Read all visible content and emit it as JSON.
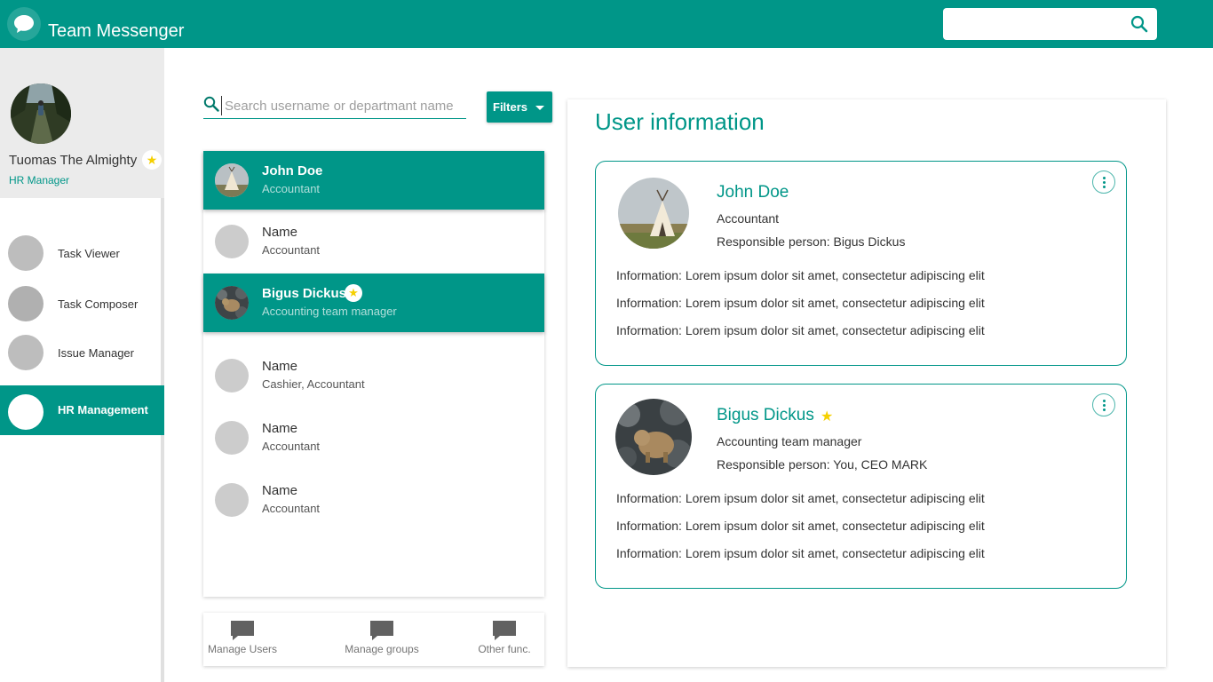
{
  "app": {
    "title": "Team Messenger",
    "accent": "#009688"
  },
  "header": {
    "search_placeholder": ""
  },
  "profile": {
    "name": "Tuomas The Almighty",
    "role": "HR Manager",
    "star": "★"
  },
  "nav": [
    {
      "label": "Task Viewer",
      "active": false
    },
    {
      "label": "Task Composer",
      "active": false
    },
    {
      "label": "Issue Manager",
      "active": false
    },
    {
      "label": "HR Management",
      "active": true
    }
  ],
  "search": {
    "placeholder": "Search username or departmant name",
    "value": ""
  },
  "filter": {
    "label": "Filters"
  },
  "users": [
    {
      "name": "John Doe",
      "role": "Accountant",
      "selected": true,
      "starred": false,
      "photo": "teepee"
    },
    {
      "name": "Name",
      "role": "Accountant",
      "selected": false,
      "starred": false,
      "photo": ""
    },
    {
      "name": "Bigus Dickus",
      "role": "Accounting team manager",
      "selected": true,
      "starred": true,
      "photo": "bear"
    },
    {
      "name": "Name",
      "role": "Cashier, Accountant",
      "selected": false,
      "starred": false,
      "photo": ""
    },
    {
      "name": "Name",
      "role": "Accountant",
      "selected": false,
      "starred": false,
      "photo": ""
    },
    {
      "name": "Name",
      "role": "Accountant",
      "selected": false,
      "starred": false,
      "photo": ""
    }
  ],
  "star_glyph": "★",
  "bottom": [
    {
      "label": "Manage Users",
      "icon": "chat-bubble-icon"
    },
    {
      "label": "Manage groups",
      "icon": "chat-bubble-icon"
    },
    {
      "label": "Other func.",
      "icon": "chat-bubble-icon"
    }
  ],
  "info": {
    "title": "User information",
    "cards": [
      {
        "name": "John Doe",
        "role": "Accountant",
        "responsible": "Responsible person: Bigus Dickus",
        "starred": false,
        "info": [
          "Information: Lorem ipsum dolor sit amet, consectetur adipiscing elit",
          "Information: Lorem ipsum dolor sit amet, consectetur adipiscing elit",
          "Information: Lorem ipsum dolor sit amet, consectetur adipiscing elit"
        ]
      },
      {
        "name": "Bigus Dickus",
        "role": "Accounting team manager",
        "responsible": "Responsible person: You, CEO MARK",
        "starred": true,
        "info": [
          "Information: Lorem ipsum dolor sit amet, consectetur adipiscing elit",
          "Information: Lorem ipsum dolor sit amet, consectetur adipiscing elit",
          "Information: Lorem ipsum dolor sit amet, consectetur adipiscing elit"
        ]
      }
    ]
  }
}
